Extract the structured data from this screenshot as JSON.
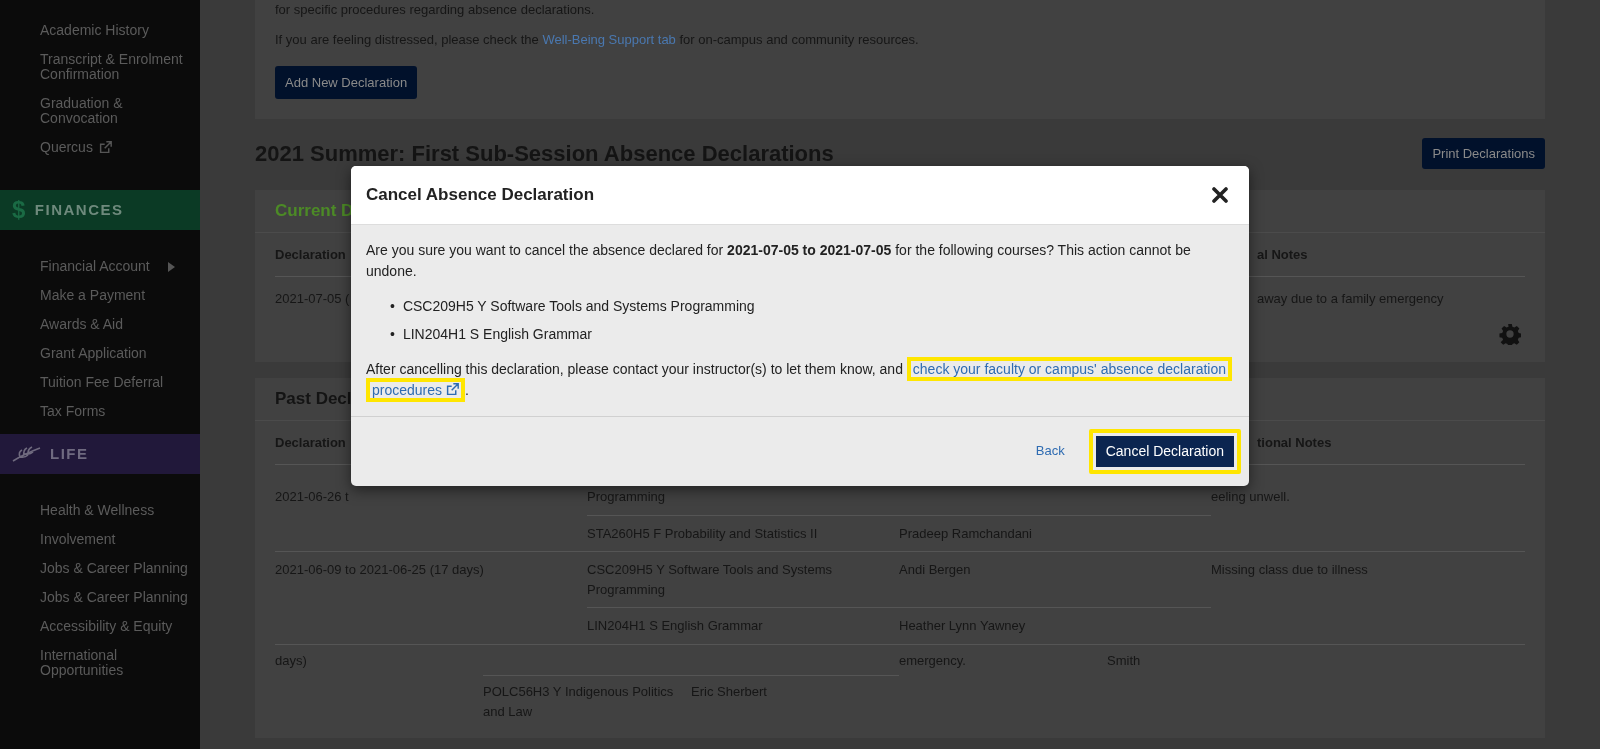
{
  "sidebar": {
    "groups": [
      {
        "items": [
          {
            "label": "Academic History",
            "external": false,
            "submenu": false
          },
          {
            "label": "Transcript & Enrolment Confirmation",
            "external": false,
            "submenu": false
          },
          {
            "label": "Graduation & Convocation",
            "external": false,
            "submenu": false
          },
          {
            "label": "Quercus",
            "external": true,
            "submenu": false
          }
        ]
      },
      {
        "heading": {
          "label": "FINANCES",
          "kind": "symbol",
          "symbol": "$",
          "color": "#0b3a25"
        },
        "items": [
          {
            "label": "Financial Account",
            "external": false,
            "submenu": true
          },
          {
            "label": "Make a Payment",
            "external": false,
            "submenu": false
          },
          {
            "label": "Awards & Aid",
            "external": false,
            "submenu": false
          },
          {
            "label": "Grant Application",
            "external": false,
            "submenu": false
          },
          {
            "label": "Tuition Fee Deferral",
            "external": false,
            "submenu": false
          },
          {
            "label": "Tax Forms",
            "external": false,
            "submenu": false
          }
        ]
      },
      {
        "heading": {
          "label": "LIFE",
          "kind": "icon",
          "color": "#21183a"
        },
        "items": [
          {
            "label": "Health & Wellness",
            "external": false,
            "submenu": false
          },
          {
            "label": "Involvement",
            "external": false,
            "submenu": false
          },
          {
            "label": "Jobs & Career Planning",
            "external": false,
            "submenu": false
          },
          {
            "label": "Jobs & Career Planning",
            "external": false,
            "submenu": false
          },
          {
            "label": "Accessibility & Equity",
            "external": false,
            "submenu": false
          },
          {
            "label": "International Opportunities",
            "external": false,
            "submenu": false
          }
        ]
      }
    ]
  },
  "intro": {
    "cut_line": "for specific procedures regarding absence declarations.",
    "distress": {
      "before": "If you are feeling distressed, please check the ",
      "link": "Well-Being Support tab",
      "after": " for on-campus and community resources."
    },
    "button": "Add New Declaration"
  },
  "session_heading": "2021 Summer: First Sub-Session Absence Declarations",
  "print_button": "Print Declarations",
  "current_declarations": {
    "title": "Current D",
    "columns": [
      "Declaration",
      "al Notes"
    ],
    "rows": [
      {
        "dates": "2021-07-05 (",
        "notes": "away due to a family emergency"
      }
    ]
  },
  "past_declarations": {
    "title": "Past Decl",
    "columns": [
      "Declaration",
      "tional Notes"
    ],
    "rows": [
      {
        "dates": "2021-06-26 t",
        "courses": [
          {
            "course": "Programming"
          },
          {
            "course": "STA260H5 F Probability and Statistics II",
            "instructor": "Pradeep Ramchandani"
          }
        ],
        "notes": "eeling unwell."
      },
      {
        "dates": "2021-06-09 to 2021-06-25 (17 days)",
        "courses": [
          {
            "course": "CSC209H5 Y Software Tools and Systems Programming",
            "instructor": "Andi Bergen"
          },
          {
            "course": "LIN204H1 S English Grammar",
            "instructor": "Heather Lynn Yawney"
          }
        ],
        "notes": "Missing class due to illness"
      }
    ],
    "fragment": [
      {
        "column_1": "days)",
        "column_4": "emergency.",
        "column_5": "Smith"
      },
      {
        "column_2": "POLC56H3 Y Indigenous Politics and Law",
        "column_3": "Eric Sherbert"
      }
    ]
  },
  "modal": {
    "title": "Cancel Absence Declaration",
    "question": "Are you sure you want to cancel the absence declared for **2021-07-05 to 2021-07-05** for the following courses? This action cannot be undone.",
    "courses": [
      {
        "bullet": "•",
        "text": "CSC209H5 Y Software Tools and Systems Programming"
      },
      {
        "bullet": "•",
        "text": "LIN204H1 S English Grammar"
      }
    ],
    "after": {
      "before": "After cancelling this declaration, please contact your instructor(s) to let them know, and ",
      "links": [
        {
          "text": "check your faculty or campus' absence declaration",
          "external": false,
          "highlighted": true
        },
        {
          "text": "procedures",
          "external": true,
          "highlighted": true
        }
      ],
      "after": "."
    },
    "back": "Back",
    "confirm": {
      "label": "Cancel Declaration",
      "highlighted": true
    }
  }
}
